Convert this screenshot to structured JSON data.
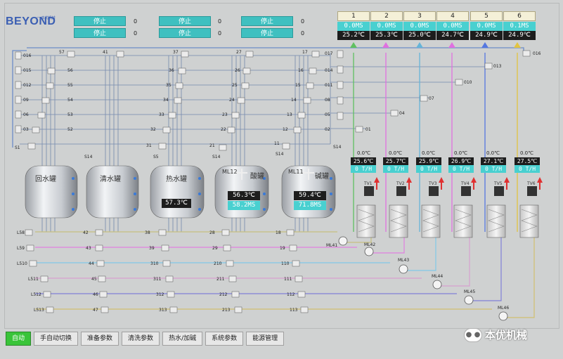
{
  "header": {
    "logo_text": "BEYOND",
    "logo_sub": "一 本优机械"
  },
  "status_buttons": [
    {
      "label": "停止",
      "value": "0"
    },
    {
      "label": "停止",
      "value": "0"
    },
    {
      "label": "停止",
      "value": "0"
    },
    {
      "label": "停止",
      "value": "0"
    },
    {
      "label": "停止",
      "value": "0"
    },
    {
      "label": "停止",
      "value": "0"
    }
  ],
  "tanks": [
    {
      "label": "回水罐"
    },
    {
      "label": "清水罐"
    },
    {
      "label": "热水罐",
      "temp": "57.3℃"
    },
    {
      "label": "酸罐",
      "tag": "ML12",
      "temp": "56.3℃",
      "conc": "58.2MS"
    },
    {
      "label": "碱罐",
      "tag": "ML11",
      "temp": "59.4℃",
      "conc": "71.8MS"
    }
  ],
  "lines": [
    {
      "num": "1",
      "ms": "0.0MS",
      "temp": "25.2℃",
      "top_temp": "0.0℃",
      "ret_temp": "25.6℃",
      "flow": "0 T/H",
      "tv": "TV1"
    },
    {
      "num": "2",
      "ms": "0.0MS",
      "temp": "25.3℃",
      "top_temp": "0.0℃",
      "ret_temp": "25.7℃",
      "flow": "0 T/H",
      "tv": "TV2"
    },
    {
      "num": "3",
      "ms": "0.0MS",
      "temp": "25.0℃",
      "top_temp": "0.0℃",
      "ret_temp": "25.9℃",
      "flow": "0 T/H",
      "tv": "TV3"
    },
    {
      "num": "4",
      "ms": "0.0MS",
      "temp": "24.7℃",
      "top_temp": "0.0℃",
      "ret_temp": "26.9℃",
      "flow": "0 T/H",
      "tv": "TV4"
    },
    {
      "num": "5",
      "ms": "0.0MS",
      "temp": "24.9℃",
      "top_temp": "0.0℃",
      "ret_temp": "27.1℃",
      "flow": "0 T/H",
      "tv": "TV5"
    },
    {
      "num": "6",
      "ms": "0.1MS",
      "temp": "24.9℃",
      "top_temp": "0.0℃",
      "ret_temp": "27.5℃",
      "flow": "0 T/H",
      "tv": "TV6"
    }
  ],
  "pumps": [
    "ML41",
    "ML42",
    "ML43",
    "ML44",
    "ML45",
    "ML46"
  ],
  "nav": [
    {
      "label": "自动",
      "active": true
    },
    {
      "label": "手自动切换"
    },
    {
      "label": "准备参数"
    },
    {
      "label": "清洗参数"
    },
    {
      "label": "热水/加碱"
    },
    {
      "label": "系统参数"
    },
    {
      "label": "能源管理"
    }
  ],
  "brand": {
    "text": "本优机械"
  }
}
